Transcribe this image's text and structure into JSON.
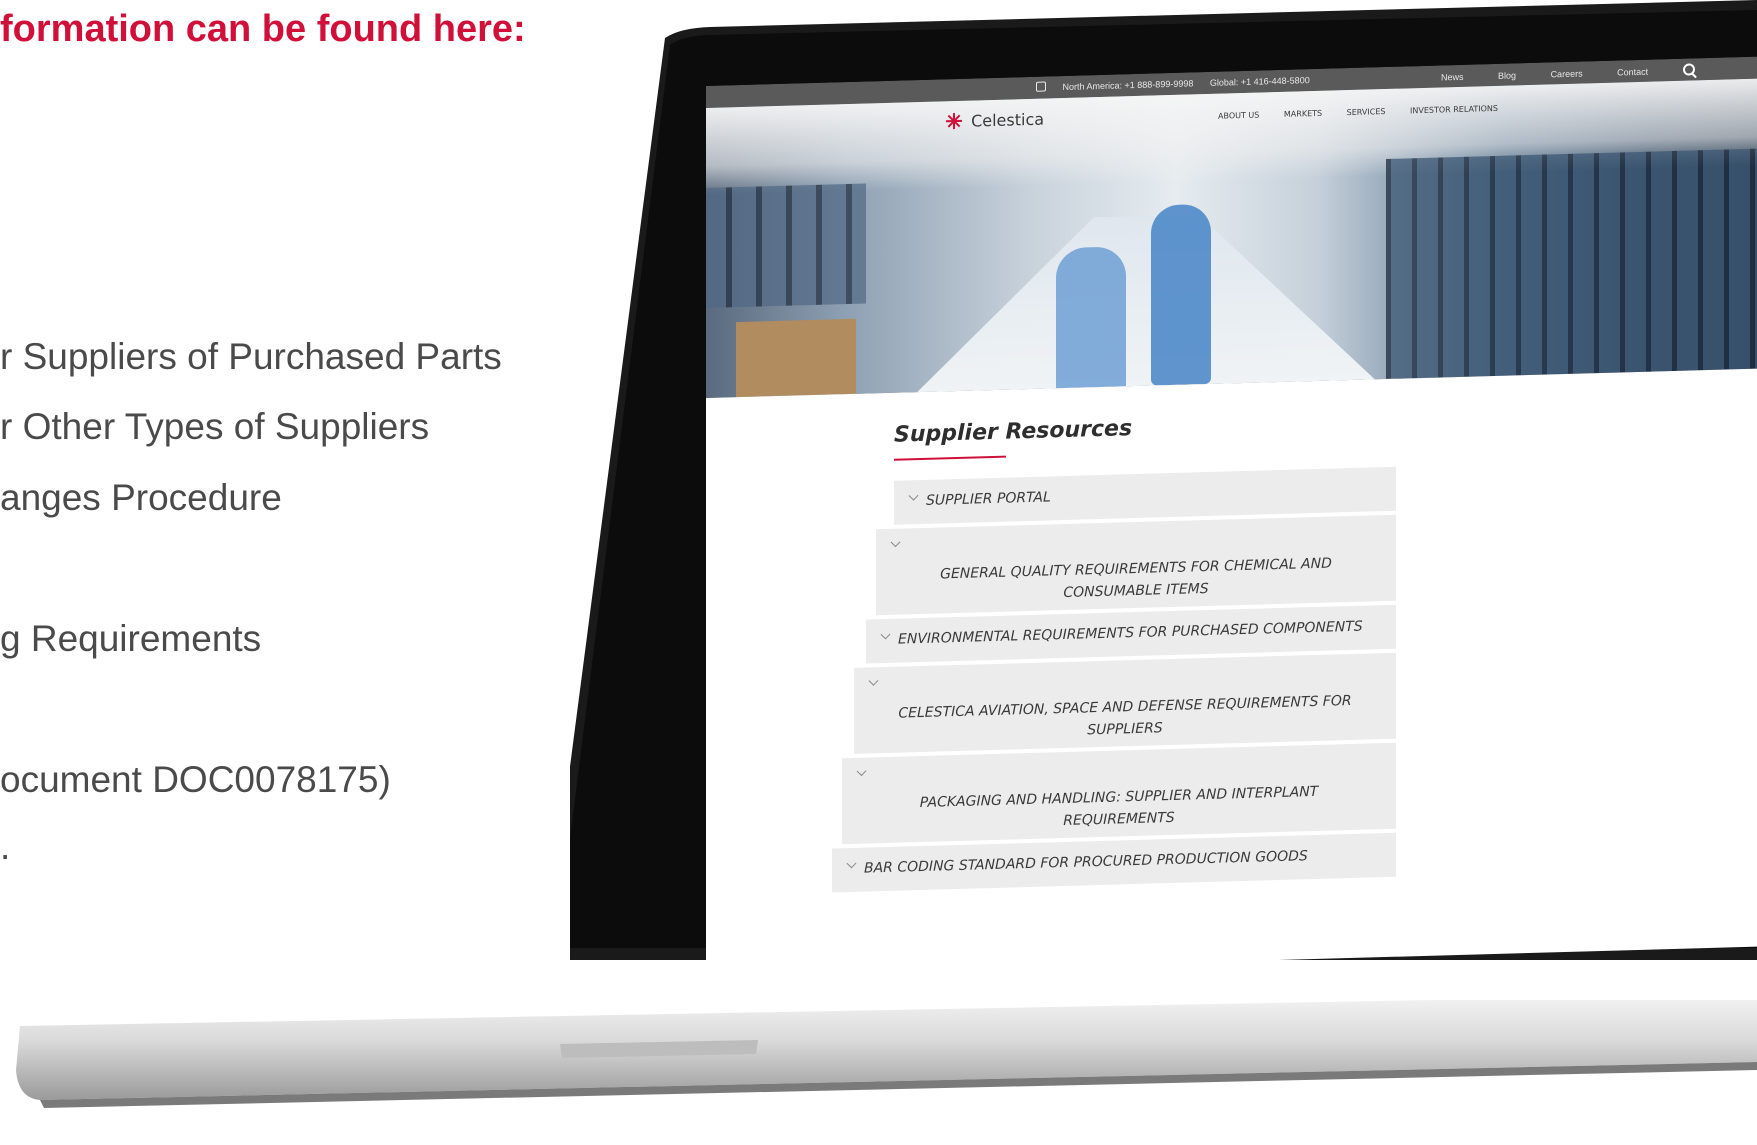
{
  "slide": {
    "heading": "formation can be found here:",
    "lines": [
      "r Suppliers of Purchased Parts",
      "r Other Types of Suppliers",
      "anges Procedure",
      "g Requirements",
      "ocument DOC0078175)",
      "."
    ]
  },
  "site": {
    "topbar": {
      "north_america": "North America: +1 888-899-9998",
      "global": "Global: +1 416-448-5800",
      "links": [
        "News",
        "Blog",
        "Careers",
        "Contact"
      ]
    },
    "brand": "Celestica",
    "nav": [
      "ABOUT US",
      "MARKETS",
      "SERVICES",
      "INVESTOR RELATIONS"
    ],
    "section_title": "Supplier Resources",
    "accordion": [
      "SUPPLIER PORTAL",
      "GENERAL QUALITY REQUIREMENTS FOR CHEMICAL AND CONSUMABLE ITEMS",
      "ENVIRONMENTAL REQUIREMENTS FOR PURCHASED COMPONENTS",
      "CELESTICA AVIATION, SPACE AND DEFENSE REQUIREMENTS FOR SUPPLIERS",
      "PACKAGING AND HANDLING: SUPPLIER AND INTERPLANT REQUIREMENTS",
      "BAR CODING STANDARD FOR PROCURED PRODUCTION GOODS"
    ]
  },
  "colors": {
    "heading_red": "#d1103a",
    "body_text": "#4a4a4a",
    "accordion_bg": "#ececec"
  }
}
